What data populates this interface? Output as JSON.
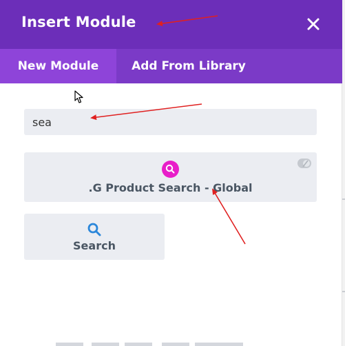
{
  "header": {
    "title": "Insert Module",
    "close_icon": "close-icon"
  },
  "tabs": [
    {
      "label": "New Module",
      "active": true
    },
    {
      "label": "Add From Library",
      "active": false
    }
  ],
  "search": {
    "value": "sea"
  },
  "modules": [
    {
      "label": ".G Product Search - Global",
      "icon": "search-icon",
      "icon_color": "#e81ec9",
      "badge_icon": "global-toggle-icon"
    },
    {
      "label": "Search",
      "icon": "search-icon",
      "icon_color": "#2b87da"
    }
  ],
  "colors": {
    "header": "#6c2eb9",
    "tab_bar": "#7b3ac7",
    "tab_active": "#8e44d9",
    "field_bg": "#ebedf2",
    "annotation_arrow": "#e02020"
  }
}
